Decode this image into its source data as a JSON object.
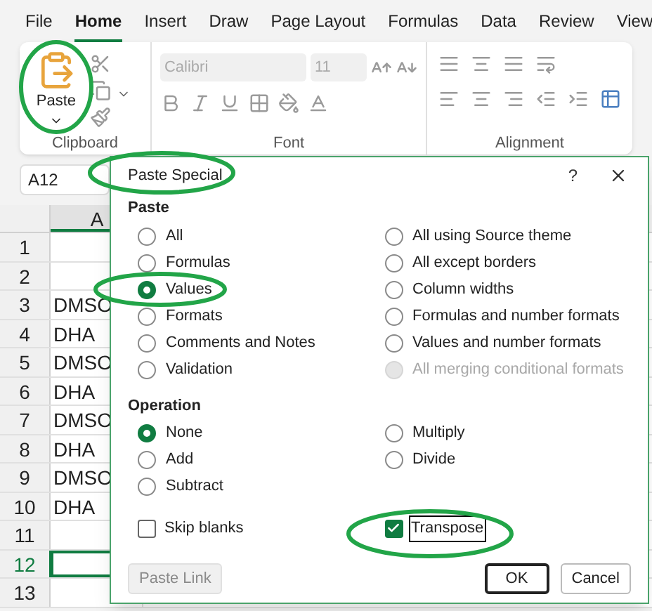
{
  "menu_tabs": [
    {
      "label": "File",
      "selected": false
    },
    {
      "label": "Home",
      "selected": true
    },
    {
      "label": "Insert",
      "selected": false
    },
    {
      "label": "Draw",
      "selected": false
    },
    {
      "label": "Page Layout",
      "selected": false
    },
    {
      "label": "Formulas",
      "selected": false
    },
    {
      "label": "Data",
      "selected": false
    },
    {
      "label": "Review",
      "selected": false
    },
    {
      "label": "View",
      "selected": false
    }
  ],
  "ribbon": {
    "clipboard": {
      "paste_label": "Paste",
      "group_label": "Clipboard"
    },
    "font": {
      "font_name": "Calibri",
      "font_size": "11",
      "group_label": "Font"
    },
    "alignment": {
      "group_label": "Alignment"
    }
  },
  "name_box": "A12",
  "sheet": {
    "column": "A",
    "rows": [
      {
        "number": "1",
        "selected": false
      },
      {
        "number": "2",
        "selected": false
      },
      {
        "number": "3",
        "value": "DMSO",
        "selected": false
      },
      {
        "number": "4",
        "value": "DHA",
        "selected": false
      },
      {
        "number": "5",
        "value": "DMSO",
        "selected": false
      },
      {
        "number": "6",
        "value": "DHA",
        "selected": false
      },
      {
        "number": "7",
        "value": "DMSO",
        "selected": false
      },
      {
        "number": "8",
        "value": "DHA",
        "selected": false
      },
      {
        "number": "9",
        "value": "DMSO",
        "selected": false
      },
      {
        "number": "10",
        "value": "DHA",
        "selected": false
      },
      {
        "number": "11",
        "selected": false
      },
      {
        "number": "12",
        "selected": true
      },
      {
        "number": "13",
        "selected": false
      }
    ]
  },
  "dialog": {
    "title": "Paste Special",
    "help": "?",
    "paste": {
      "heading": "Paste",
      "columns": [
        [
          {
            "label": "All",
            "selected": false,
            "disabled": false
          },
          {
            "label": "Formulas",
            "selected": false,
            "disabled": false
          },
          {
            "label": "Values",
            "selected": true,
            "disabled": false
          },
          {
            "label": "Formats",
            "selected": false,
            "disabled": false
          },
          {
            "label": "Comments and Notes",
            "selected": false,
            "disabled": false
          },
          {
            "label": "Validation",
            "selected": false,
            "disabled": false
          }
        ],
        [
          {
            "label": "All using Source theme",
            "selected": false,
            "disabled": false
          },
          {
            "label": "All except borders",
            "selected": false,
            "disabled": false
          },
          {
            "label": "Column widths",
            "selected": false,
            "disabled": false
          },
          {
            "label": "Formulas and number formats",
            "selected": false,
            "disabled": false
          },
          {
            "label": "Values and number formats",
            "selected": false,
            "disabled": false
          },
          {
            "label": "All merging conditional formats",
            "selected": false,
            "disabled": true
          }
        ]
      ]
    },
    "operation": {
      "heading": "Operation",
      "columns": [
        [
          {
            "label": "None",
            "selected": true
          },
          {
            "label": "Add",
            "selected": false
          },
          {
            "label": "Subtract",
            "selected": false
          }
        ],
        [
          {
            "label": "Multiply",
            "selected": false
          },
          {
            "label": "Divide",
            "selected": false
          }
        ]
      ]
    },
    "checkboxes": [
      {
        "label": "Skip blanks",
        "checked": false,
        "focused": false
      },
      {
        "label": "Transpose",
        "checked": true,
        "focused": true
      }
    ],
    "buttons": [
      {
        "label": "Paste Link",
        "disabled": true,
        "default": false
      },
      {
        "label": "OK",
        "disabled": false,
        "default": true
      },
      {
        "label": "Cancel",
        "disabled": false,
        "default": false
      }
    ]
  }
}
